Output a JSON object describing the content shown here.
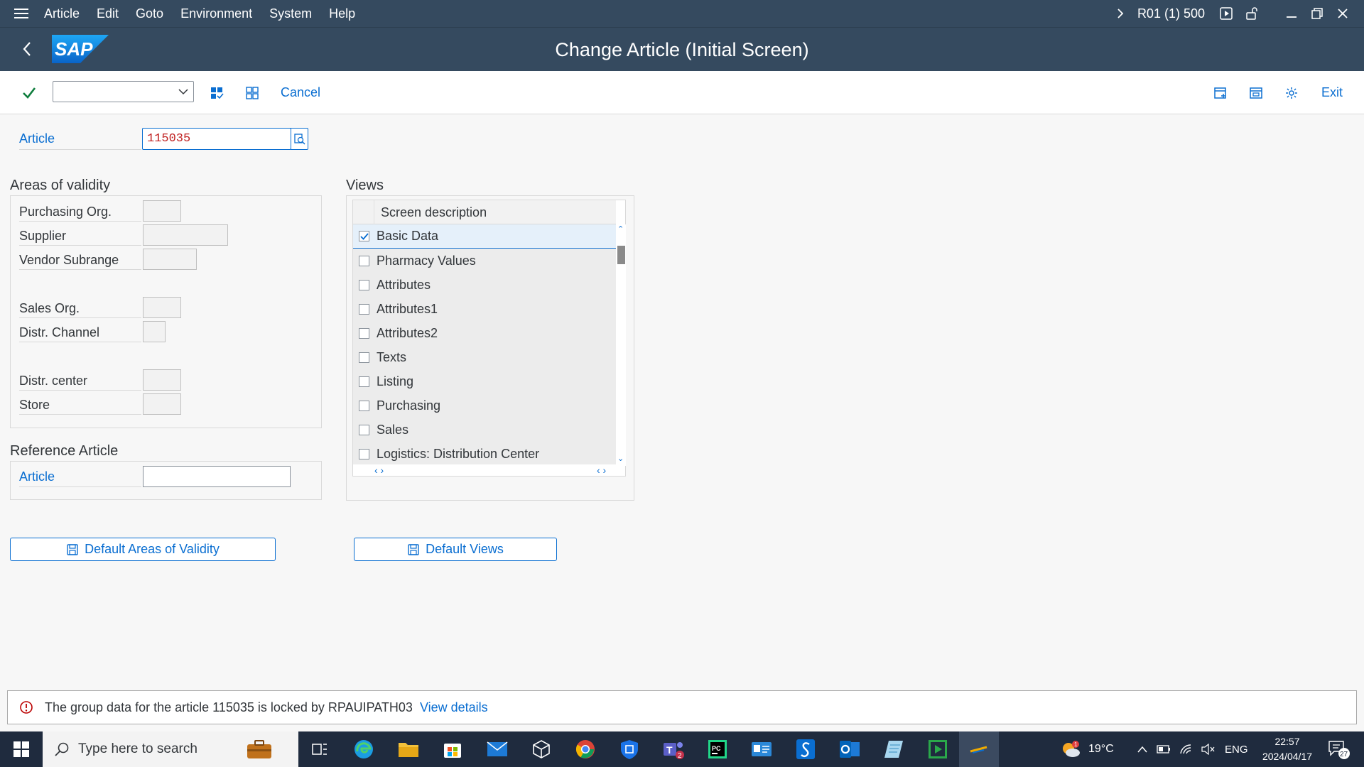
{
  "menubar": {
    "items": [
      "Article",
      "Edit",
      "Goto",
      "Environment",
      "System",
      "Help"
    ],
    "system_info": "R01 (1) 500"
  },
  "shell": {
    "title": "Change Article (Initial Screen)",
    "logo_text": "SAP"
  },
  "toolbar": {
    "command_field_value": "",
    "cancel_label": "Cancel",
    "exit_label": "Exit"
  },
  "article": {
    "label": "Article",
    "value": "115035"
  },
  "areas": {
    "title": "Areas of validity",
    "fields": [
      {
        "label": "Purchasing Org.",
        "value": ""
      },
      {
        "label": "Supplier",
        "value": ""
      },
      {
        "label": "Vendor Subrange",
        "value": ""
      },
      {
        "label": "Sales Org.",
        "value": ""
      },
      {
        "label": "Distr. Channel",
        "value": ""
      },
      {
        "label": "Distr. center",
        "value": ""
      },
      {
        "label": "Store",
        "value": ""
      }
    ]
  },
  "reference": {
    "title": "Reference Article",
    "label": "Article",
    "value": ""
  },
  "views": {
    "title": "Views",
    "column_header": "Screen description",
    "rows": [
      {
        "label": "Basic Data",
        "checked": true
      },
      {
        "label": "Pharmacy Values",
        "checked": false
      },
      {
        "label": "Attributes",
        "checked": false
      },
      {
        "label": "Attributes1",
        "checked": false
      },
      {
        "label": "Attributes2",
        "checked": false
      },
      {
        "label": "Texts",
        "checked": false
      },
      {
        "label": "Listing",
        "checked": false
      },
      {
        "label": "Purchasing",
        "checked": false
      },
      {
        "label": "Sales",
        "checked": false
      },
      {
        "label": "Logistics: Distribution Center",
        "checked": false
      }
    ]
  },
  "buttons": {
    "default_areas": "Default Areas of Validity",
    "default_views": "Default Views"
  },
  "message": {
    "text": "The group data for the article 115035 is locked by RPAUIPATH03",
    "link": "View details"
  },
  "taskbar": {
    "search_placeholder": "Type here to search",
    "weather": "19°C",
    "language": "ENG",
    "time": "22:57",
    "date": "2024/04/17",
    "notifications": "27",
    "teams_badge": "2",
    "weather_badge": "1"
  },
  "colors": {
    "shell": "#354a5f",
    "accent": "#0a6ed1",
    "article_value": "#c12222",
    "confirm": "#107e3e",
    "error": "#bb0000"
  }
}
